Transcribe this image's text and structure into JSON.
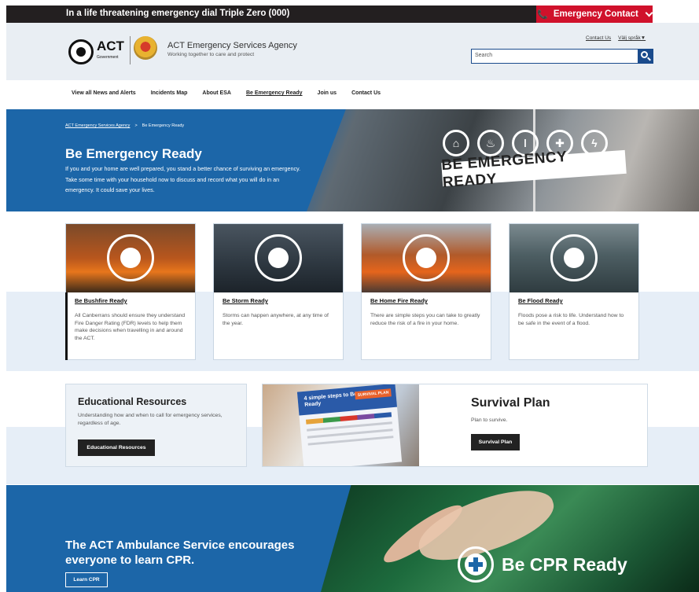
{
  "topbar": {
    "message": "In a life threatening emergency dial Triple Zero (000)",
    "emergency_button": "Emergency Contact",
    "phone_icon": "phone-icon",
    "accent": "#d0112b"
  },
  "header": {
    "act_logo_text": "ACT",
    "act_logo_sub": "Government",
    "org_name": "ACT Emergency Services Agency",
    "org_tagline": "Working together to care and protect",
    "contact_link": "Contact Us",
    "language_link": "Välj språk▼",
    "search_placeholder": "Search"
  },
  "nav": {
    "items": [
      {
        "label": "View all News and Alerts"
      },
      {
        "label": "Incidents Map"
      },
      {
        "label": "About ESA"
      },
      {
        "label": "Be Emergency Ready"
      },
      {
        "label": "Join us"
      },
      {
        "label": "Contact Us"
      }
    ],
    "active": "Be Emergency Ready"
  },
  "hero": {
    "breadcrumb": [
      "ACT Emergency Services Agency",
      "Be Emergency Ready"
    ],
    "title": "Be Emergency Ready",
    "text": "If you and your home are well prepared, you stand a better chance of surviving an emergency. Take some time with your household now to discuss and record what you will do in an emergency. It could save your lives.",
    "banner_text": "BE EMERGENCY READY",
    "banner_icons": [
      "house-icon",
      "fire-icon",
      "thermometer-icon",
      "first-aid-icon",
      "storm-icon"
    ],
    "color": "#1c66a8"
  },
  "cards": [
    {
      "title": "Be Bushfire Ready",
      "text": "All Canberrans should ensure they understand Fire Danger Rating (FDR) levels to help them make decisions when travelling in and around the ACT.",
      "icon": "fire-icon"
    },
    {
      "title": "Be Storm Ready",
      "text": "Storms can happen anywhere, at any time of the year.",
      "icon": "storm-icon"
    },
    {
      "title": "Be Home Fire Ready",
      "text": "There are simple steps you can take to greatly reduce the risk of a fire in your home.",
      "icon": "fire-icon"
    },
    {
      "title": "Be Flood Ready",
      "text": "Floods pose a risk to life. Understand how to be safe in the event of a flood.",
      "icon": "flood-waves-icon"
    }
  ],
  "education": {
    "title": "Educational Resources",
    "text": "Understanding how and when to call for emergency services, regardless of age.",
    "button": "Educational Resources"
  },
  "survival": {
    "title": "Survival Plan",
    "text": "Plan to survive.",
    "button": "Survival Plan",
    "poster_title": "4 simple steps to Be Emergency Ready",
    "poster_tag": "SURVIVAL PLAN"
  },
  "cpr": {
    "title": "The ACT Ambulance Service encourages everyone to learn CPR.",
    "button": "Learn CPR",
    "brand": "Be CPR Ready"
  }
}
